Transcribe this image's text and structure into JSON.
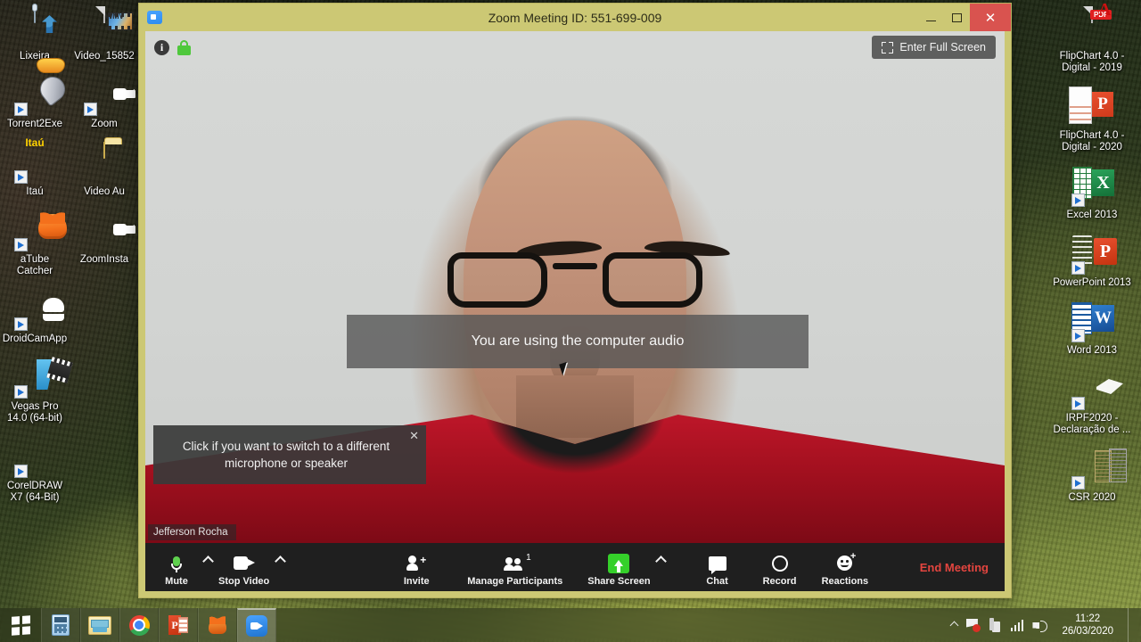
{
  "desktop": {
    "icons_left": [
      {
        "label": "Lixeira",
        "icon": "recycle-bin-icon",
        "art": "art-trash",
        "shortcut": false
      },
      {
        "label": "Video_15852",
        "icon": "wmv-video-file-icon",
        "art": "art-wmv",
        "shortcut": false
      },
      {
        "label": "Torrent2Exe",
        "icon": "torrent2exe-icon",
        "art": "art-torrent",
        "shortcut": true
      },
      {
        "label": "Zoom",
        "icon": "zoom-app-icon",
        "art": "art-zoom",
        "shortcut": true
      },
      {
        "label": "Itaú",
        "icon": "itau-bank-icon",
        "art": "art-itau",
        "shortcut": true
      },
      {
        "label": "Video Au",
        "icon": "folder-icon",
        "art": "art-folder",
        "shortcut": false
      },
      {
        "label": "aTube Catcher",
        "icon": "atube-catcher-icon",
        "art": "art-atube",
        "shortcut": true
      },
      {
        "label": "ZoomInsta",
        "icon": "zoom-installer-icon",
        "art": "art-zoom",
        "shortcut": false
      },
      {
        "label": "DroidCamApp",
        "icon": "droidcam-icon",
        "art": "art-droid",
        "shortcut": true
      },
      {
        "label": "Vegas Pro 14.0 (64-bit)",
        "icon": "vegas-pro-icon",
        "art": "art-vegas",
        "shortcut": true
      },
      {
        "label": "CorelDRAW X7 (64-Bit)",
        "icon": "coreldraw-icon",
        "art": "art-corel",
        "shortcut": true
      }
    ],
    "icons_right": [
      {
        "label": "FlipChart 4.0 - Digital - 2019",
        "icon": "pdf-file-icon",
        "art": "art-pdf",
        "shortcut": false
      },
      {
        "label": "FlipChart 4.0 - Digital - 2020",
        "icon": "powerpoint-file-icon",
        "art": "art-ppt",
        "shortcut": false
      },
      {
        "label": "Excel 2013",
        "icon": "excel-app-icon",
        "art": "art-excel",
        "shortcut": true
      },
      {
        "label": "PowerPoint 2013",
        "icon": "powerpoint-app-icon",
        "art": "art-ppt2",
        "shortcut": true
      },
      {
        "label": "Word 2013",
        "icon": "word-app-icon",
        "art": "art-word",
        "shortcut": true
      },
      {
        "label": "IRPF2020 - Declaração de ...",
        "icon": "irpf2020-icon",
        "art": "art-irpf",
        "shortcut": true
      },
      {
        "label": "CSR 2020",
        "icon": "csr-documents-icon",
        "art": "art-csr",
        "shortcut": true
      }
    ]
  },
  "window": {
    "title": "Zoom Meeting ID: 551-699-009",
    "app_icon": "zoom-app-icon",
    "controls": {
      "minimize": "─",
      "maximize": "☐",
      "close": "✕"
    },
    "frame_color": "#ccc874",
    "close_color": "#d9534f"
  },
  "stage": {
    "info_icon_label": "i",
    "lock_icon": "encryption-lock-icon",
    "fullscreen_label": "Enter Full Screen",
    "audio_banner": "You are using the computer audio",
    "participant_name": "Jefferson Rocha",
    "mic_tooltip": {
      "text": "Click if you want to switch to a different microphone or speaker",
      "close": "✕"
    }
  },
  "toolbar": {
    "mute_label": "Mute",
    "mute_icon": "microphone-icon",
    "audio_caret_icon": "chevron-up-icon",
    "video_label": "Stop Video",
    "video_icon": "camera-icon",
    "video_caret_icon": "chevron-up-icon",
    "invite_label": "Invite",
    "invite_icon": "invite-person-icon",
    "participants_label": "Manage Participants",
    "participants_icon": "people-icon",
    "participants_count": "1",
    "share_label": "Share Screen",
    "share_icon": "share-screen-arrow-icon",
    "share_caret_icon": "chevron-up-icon",
    "chat_label": "Chat",
    "chat_icon": "chat-bubble-icon",
    "record_label": "Record",
    "record_icon": "record-circle-icon",
    "reactions_label": "Reactions",
    "reactions_icon": "reactions-smiley-icon",
    "end_label": "End Meeting",
    "end_color": "#e3453f",
    "share_button_color": "#35d02a",
    "background": "#1f1f1f"
  },
  "taskbar": {
    "start_icon": "windows-start-icon",
    "apps": [
      {
        "name": "calculator",
        "icon": "calculator-icon",
        "art": "ta-calc",
        "active": false
      },
      {
        "name": "file-explorer",
        "icon": "file-explorer-icon",
        "art": "ta-explorer",
        "active": false
      },
      {
        "name": "google-chrome",
        "icon": "chrome-icon",
        "art": "ta-chrome",
        "active": false
      },
      {
        "name": "powerpoint",
        "icon": "powerpoint-icon",
        "art": "ta-ppt",
        "active": false
      },
      {
        "name": "atube-catcher",
        "icon": "atube-catcher-icon",
        "art": "ta-atube",
        "active": false
      },
      {
        "name": "zoom",
        "icon": "zoom-icon",
        "art": "ta-zoom",
        "active": true
      }
    ],
    "tray": {
      "caret_icon": "show-hidden-icons-chevron",
      "flag_icon": "action-center-flag-icon",
      "usb_icon": "safely-remove-hardware-icon",
      "network_icon": "network-signal-icon",
      "volume_icon": "volume-speaker-icon"
    },
    "clock": {
      "time": "11:22",
      "date": "26/03/2020"
    }
  }
}
